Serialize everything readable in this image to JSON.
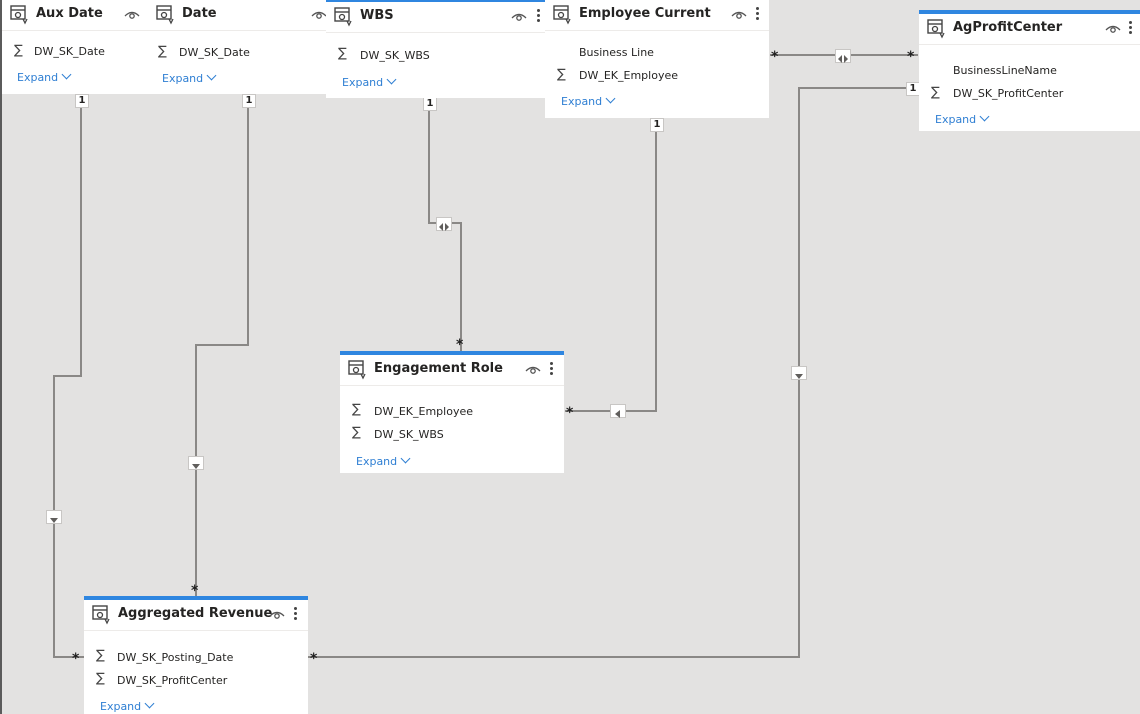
{
  "tables": {
    "aux_date": {
      "title": "Aux Date",
      "fields": [
        {
          "label": "DW_SK_Date",
          "sigma": "∑"
        }
      ],
      "expand": "Expand"
    },
    "date": {
      "title": "Date",
      "fields": [
        {
          "label": "DW_SK_Date",
          "sigma": "∑"
        }
      ],
      "expand": "Expand"
    },
    "wbs": {
      "title": "WBS",
      "fields": [
        {
          "label": "DW_SK_WBS",
          "sigma": "∑"
        }
      ],
      "expand": "Expand"
    },
    "employee_current": {
      "title": "Employee Current",
      "fields": [
        {
          "label": "Business Line",
          "sigma": ""
        },
        {
          "label": "DW_EK_Employee",
          "sigma": "∑"
        }
      ],
      "expand": "Expand"
    },
    "ag_profit_center": {
      "title": "AgProfitCenter",
      "fields": [
        {
          "label": "BusinessLineName",
          "sigma": ""
        },
        {
          "label": "DW_SK_ProfitCenter",
          "sigma": "∑"
        }
      ],
      "expand": "Expand"
    },
    "engagement_role": {
      "title": "Engagement Role",
      "fields": [
        {
          "label": "DW_EK_Employee",
          "sigma": "∑"
        },
        {
          "label": "DW_SK_WBS",
          "sigma": "∑"
        }
      ],
      "expand": "Expand"
    },
    "aggregated_revenue": {
      "title": "Aggregated Revenue",
      "fields": [
        {
          "label": "DW_SK_Posting_Date",
          "sigma": "∑"
        },
        {
          "label": "DW_SK_ProfitCenter",
          "sigma": "∑"
        }
      ],
      "expand": "Expand"
    }
  },
  "cardinality": {
    "one": "1",
    "many": "*"
  },
  "colors": {
    "accent": "#2f86e0",
    "line": "#8a8886",
    "link": "#2f7fd3",
    "canvas": "#e3e2e1"
  },
  "icons": {
    "table": "table-icon",
    "visibility": "eye-icon",
    "more": "more-options-icon",
    "filter_single": "filter-arrow-icon",
    "filter_both": "bidirectional-filter-icon"
  }
}
